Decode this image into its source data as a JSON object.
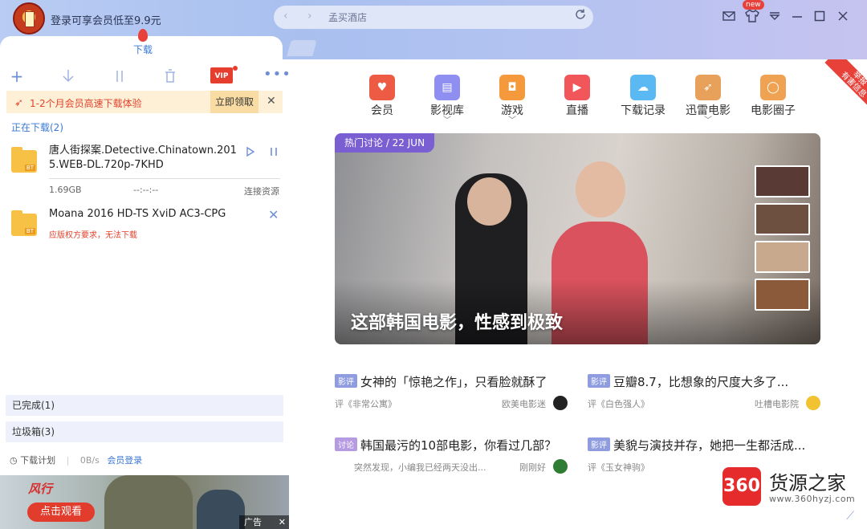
{
  "header": {
    "promo_login": "登录可享会员低至9.9元",
    "search_text": "孟买酒店",
    "new_badge": "new",
    "active_tab": "下载"
  },
  "toolbar": {
    "vip_label": "VIP",
    "more": "•••"
  },
  "promo": {
    "text": "1-2个月会员高速下载体验",
    "claim_label": "立即领取",
    "close": "✕"
  },
  "downloading": {
    "title": "正在下载(2)",
    "items": [
      {
        "name_line1": "唐人街探案.Detective.Chinatown.201",
        "name_line2": "5.WEB-DL.720p-7KHD",
        "size": "1.69GB",
        "time": "--:--:--",
        "status": "连接资源"
      },
      {
        "name_line1": "Moana 2016 HD-TS XviD AC3-CPG",
        "error": "应版权方要求，无法下载"
      }
    ]
  },
  "left_tabs": {
    "completed": "已完成(1)",
    "trash": "垃圾箱(3)"
  },
  "footer": {
    "schedule": "下载计划",
    "speed": "0B/s",
    "member_login": "会员登录"
  },
  "ad": {
    "brand": "风行",
    "watch_button": "点击观看",
    "tag": "广告"
  },
  "nav": {
    "items": [
      {
        "label": "会员",
        "icon": "heart-badge-icon",
        "color": "#ee5b45",
        "chevron": false
      },
      {
        "label": "影视库",
        "icon": "film-icon",
        "color": "#8e8ff0",
        "chevron": true
      },
      {
        "label": "游戏",
        "icon": "gamepad-icon",
        "color": "#f49a3c",
        "chevron": true
      },
      {
        "label": "直播",
        "icon": "tv-icon",
        "color": "#f0565a",
        "chevron": false
      },
      {
        "label": "下载记录",
        "icon": "cloud-icon",
        "color": "#5ab8f3",
        "chevron": false
      },
      {
        "label": "迅雷电影",
        "icon": "bird-icon",
        "color": "#e8a15a",
        "chevron": true
      },
      {
        "label": "电影圈子",
        "icon": "circle-icon",
        "color": "#f0a253",
        "chevron": false
      }
    ]
  },
  "banner": {
    "tag": "热门讨论 / 22 JUN",
    "headline": "这部韩国电影，性感到极致"
  },
  "articles": [
    {
      "badge": "影评",
      "title": "女神的「惊艳之作」，只看脸就酥了",
      "sub": "评《非常公寓》",
      "source": "欧美电影迷"
    },
    {
      "badge": "影评",
      "title": "豆瓣8.7，比想象的尺度大多了...",
      "sub": "评《白色强人》",
      "source": "吐槽电影院"
    },
    {
      "badge": "讨论",
      "title": "韩国最污的10部电影，你看过几部？",
      "sub": "突然发现，小编我已经两天没出...",
      "source": "刚刚好"
    },
    {
      "badge": "影评",
      "title": "美貌与演技并存，她把一生都活成...",
      "sub": "评《玉女神驹》",
      "source": ""
    }
  ],
  "corner_ribbon": {
    "line1": "举报",
    "line2": "有害信息"
  },
  "watermark": {
    "logo": "360",
    "name": "货源之家",
    "url": "www.360hyzj.com"
  }
}
